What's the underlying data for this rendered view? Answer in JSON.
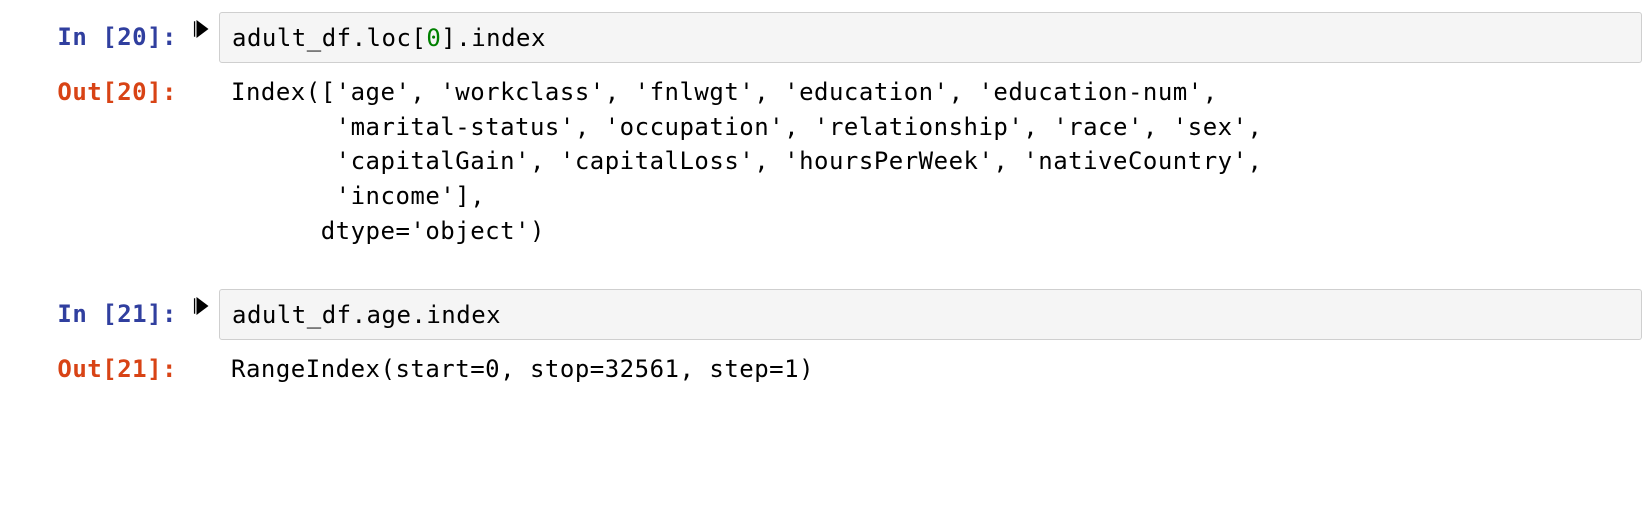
{
  "cells": {
    "c0": {
      "in_prompt": "In [20]:",
      "out_prompt": "Out[20]:",
      "code": {
        "prefix": "adult_df.loc[",
        "num": "0",
        "suffix": "].index"
      },
      "output": "Index(['age', 'workclass', 'fnlwgt', 'education', 'education-num',\n       'marital-status', 'occupation', 'relationship', 'race', 'sex',\n       'capitalGain', 'capitalLoss', 'hoursPerWeek', 'nativeCountry',\n       'income'],\n      dtype='object')"
    },
    "c1": {
      "in_prompt": "In [21]:",
      "out_prompt": "Out[21]:",
      "code_plain": "adult_df.age.index",
      "output": "RangeIndex(start=0, stop=32561, step=1)"
    }
  }
}
